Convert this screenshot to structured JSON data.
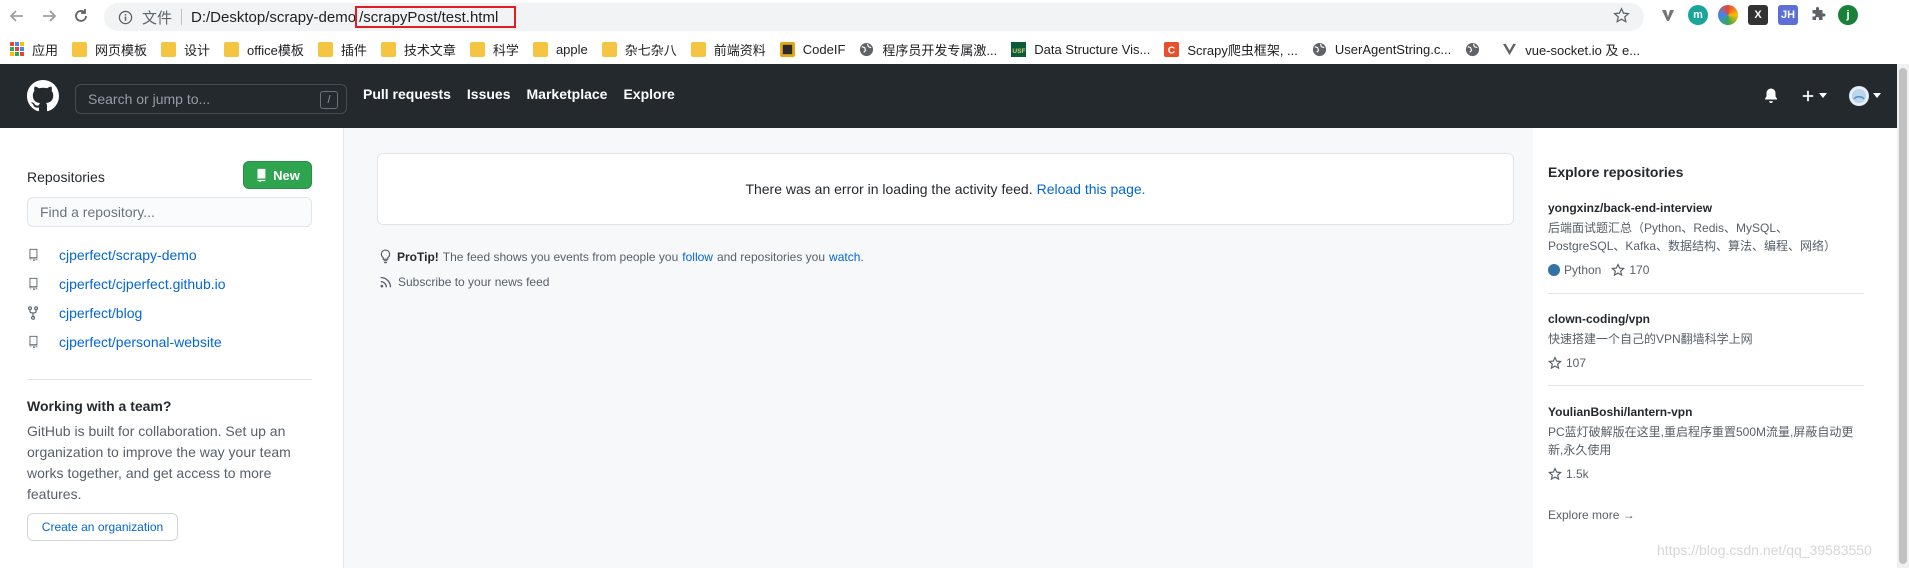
{
  "browser": {
    "scheme_label": "文件",
    "url_path": "D:/Desktop/scrapy-demo",
    "url_highlight": "/scrapyPost/test.html",
    "extensions": [
      {
        "icon": "v-extension-icon",
        "color": "#757575",
        "label": "V"
      },
      {
        "icon": "m-extension-icon",
        "color": "#1aa59a",
        "label": "m"
      },
      {
        "icon": "color-wheel-icon",
        "color": "#ea4335",
        "label": ""
      },
      {
        "icon": "x-extension-icon",
        "color": "#333333",
        "label": "X"
      },
      {
        "icon": "jh-extension-icon",
        "color": "#5b6fd6",
        "label": "JH"
      },
      {
        "icon": "puzzle-icon",
        "color": "#5f6368",
        "label": ""
      },
      {
        "icon": "profile-avatar-icon",
        "color": "#188038",
        "label": "j"
      }
    ],
    "bookmarks": [
      {
        "label": "应用",
        "icon": "apps-icon"
      },
      {
        "label": "网页模板",
        "icon": "folder-icon"
      },
      {
        "label": "设计",
        "icon": "folder-icon"
      },
      {
        "label": "office模板",
        "icon": "folder-icon"
      },
      {
        "label": "插件",
        "icon": "folder-icon"
      },
      {
        "label": "技术文章",
        "icon": "folder-icon"
      },
      {
        "label": "科学",
        "icon": "folder-icon"
      },
      {
        "label": "apple",
        "icon": "folder-icon"
      },
      {
        "label": "杂七杂八",
        "icon": "folder-icon"
      },
      {
        "label": "前端资料",
        "icon": "folder-icon"
      },
      {
        "label": "CodeIF",
        "icon": "codeif-icon"
      },
      {
        "label": "程序员开发专属激...",
        "icon": "globe-icon"
      },
      {
        "label": "Data Structure Vis...",
        "icon": "usf-icon"
      },
      {
        "label": "Scrapy爬虫框架, ...",
        "icon": "csdn-icon"
      },
      {
        "label": "UserAgentString.c...",
        "icon": "globe-icon"
      },
      {
        "label": "",
        "icon": "globe-icon"
      },
      {
        "label": "vue-socket.io 及 e...",
        "icon": "vue-icon"
      }
    ]
  },
  "header": {
    "search_placeholder": "Search or jump to...",
    "slash_key": "/",
    "nav": [
      "Pull requests",
      "Issues",
      "Marketplace",
      "Explore"
    ]
  },
  "sidebar": {
    "repos_title": "Repositories",
    "new_label": "New",
    "find_placeholder": "Find a repository...",
    "repos": [
      {
        "name": "cjperfect/scrapy-demo",
        "icon": "repo-icon"
      },
      {
        "name": "cjperfect/cjperfect.github.io",
        "icon": "repo-icon"
      },
      {
        "name": "cjperfect/blog",
        "icon": "fork-icon"
      },
      {
        "name": "cjperfect/personal-website",
        "icon": "repo-icon"
      }
    ],
    "team_title": "Working with a team?",
    "team_text": "GitHub is built for collaboration. Set up an organization to improve the way your team works together, and get access to more features.",
    "org_button": "Create an organization"
  },
  "feed": {
    "error_text": "There was an error in loading the activity feed.",
    "reload_link": "Reload this page.",
    "protip_label": "ProTip!",
    "protip_text_1": "The feed shows you events from people you",
    "protip_follow": "follow",
    "protip_text_2": "and repositories you",
    "protip_watch": "watch.",
    "subscribe_text": "Subscribe to your news feed"
  },
  "explore": {
    "title": "Explore repositories",
    "repos": [
      {
        "name": "yongxinz/back-end-interview",
        "desc": "后端面试题汇总（Python、Redis、MySQL、PostgreSQL、Kafka、数据结构、算法、编程、网络）",
        "language": "Python",
        "stars": "170"
      },
      {
        "name": "clown-coding/vpn",
        "desc": "快速搭建一个自己的VPN翻墙科学上网",
        "language": "",
        "stars": "107"
      },
      {
        "name": "YoulianBoshi/lantern-vpn",
        "desc": "PC蓝灯破解版在这里,重启程序重置500M流量,屏蔽自动更新,永久使用",
        "language": "",
        "stars": "1.5k"
      }
    ],
    "more": "Explore more →"
  },
  "watermark": "https://blog.csdn.net/qq_39583550"
}
